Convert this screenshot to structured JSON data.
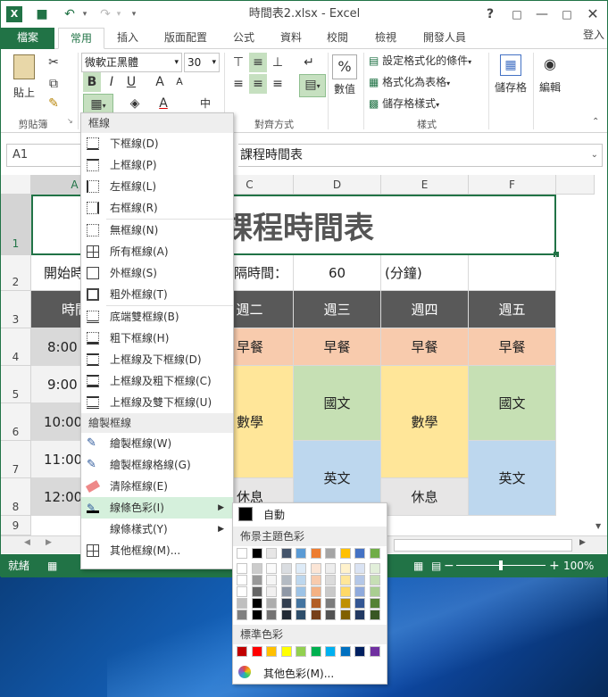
{
  "titlebar": {
    "title": "時間表2.xlsx - Excel",
    "help": "?",
    "app_icon_label": "X"
  },
  "tabs": [
    "檔案",
    "常用",
    "插入",
    "版面配置",
    "公式",
    "資料",
    "校閱",
    "檢視",
    "開發人員"
  ],
  "user_label": "登入",
  "ribbon": {
    "paste_label": "貼上",
    "clipboard_label": "剪貼簿",
    "font_name": "微軟正黑體",
    "font_size": "30",
    "align_label": "對齊方式",
    "number_label": "數值",
    "cond_format": "設定格式化的條件",
    "format_table": "格式化為表格",
    "cell_style": "儲存格樣式",
    "styles_label": "樣式",
    "cells_label": "儲存格",
    "editing_label": "編輯"
  },
  "formula": {
    "name_box": "A1",
    "content": "課程時間表"
  },
  "columns": [
    "A",
    "B",
    "C",
    "D",
    "E",
    "F"
  ],
  "rows": [
    "1",
    "2",
    "3",
    "4",
    "5",
    "6",
    "7",
    "8",
    "9"
  ],
  "sheet": {
    "title": "課程時間表",
    "start_label": "開始時",
    "interval_label": "隔時間：",
    "interval_value": "60",
    "unit": "(分鐘)",
    "time_header": "時間",
    "days": [
      "週二",
      "週三",
      "週四",
      "週五"
    ],
    "breakfast": "早餐",
    "times": [
      "8:00 A",
      "9:00 A",
      "10:00",
      "11:00",
      "12:00"
    ],
    "math": "數學",
    "chinese": "國文",
    "english": "英文",
    "rest": "休息"
  },
  "colors": {
    "excel_green": "#217346",
    "header_dark": "#595959",
    "breakfast": "#f8cbad",
    "yellow": "#ffe699",
    "green": "#c6e0b4",
    "blue": "#bdd7ee",
    "gray": "#e7e6e6"
  },
  "border_menu": {
    "header": "框線",
    "items": [
      "下框線(D)",
      "上框線(P)",
      "左框線(L)",
      "右框線(R)",
      "無框線(N)",
      "所有框線(A)",
      "外框線(S)",
      "粗外框線(T)",
      "底端雙框線(B)",
      "粗下框線(H)",
      "上框線及下框線(D)",
      "上框線及粗下框線(C)",
      "上框線及雙下框線(U)"
    ],
    "draw_header": "繪製框線",
    "draw_items": [
      "繪製框線(W)",
      "繪製框線格線(G)",
      "清除框線(E)",
      "線條色彩(I)",
      "線條樣式(Y)",
      "其他框線(M)..."
    ]
  },
  "color_menu": {
    "auto": "自動",
    "theme_label": "佈景主題色彩",
    "standard_label": "標準色彩",
    "more": "其他色彩(M)...",
    "theme_colors": [
      "#ffffff",
      "#000000",
      "#e7e6e6",
      "#44546a",
      "#5b9bd5",
      "#ed7d31",
      "#a5a5a5",
      "#ffc000",
      "#4472c4",
      "#70ad47"
    ],
    "standard_colors": [
      "#c00000",
      "#ff0000",
      "#ffc000",
      "#ffff00",
      "#92d050",
      "#00b050",
      "#00b0f0",
      "#0070c0",
      "#002060",
      "#7030a0"
    ]
  },
  "status": {
    "ready": "就緒",
    "zoom": "100%"
  }
}
